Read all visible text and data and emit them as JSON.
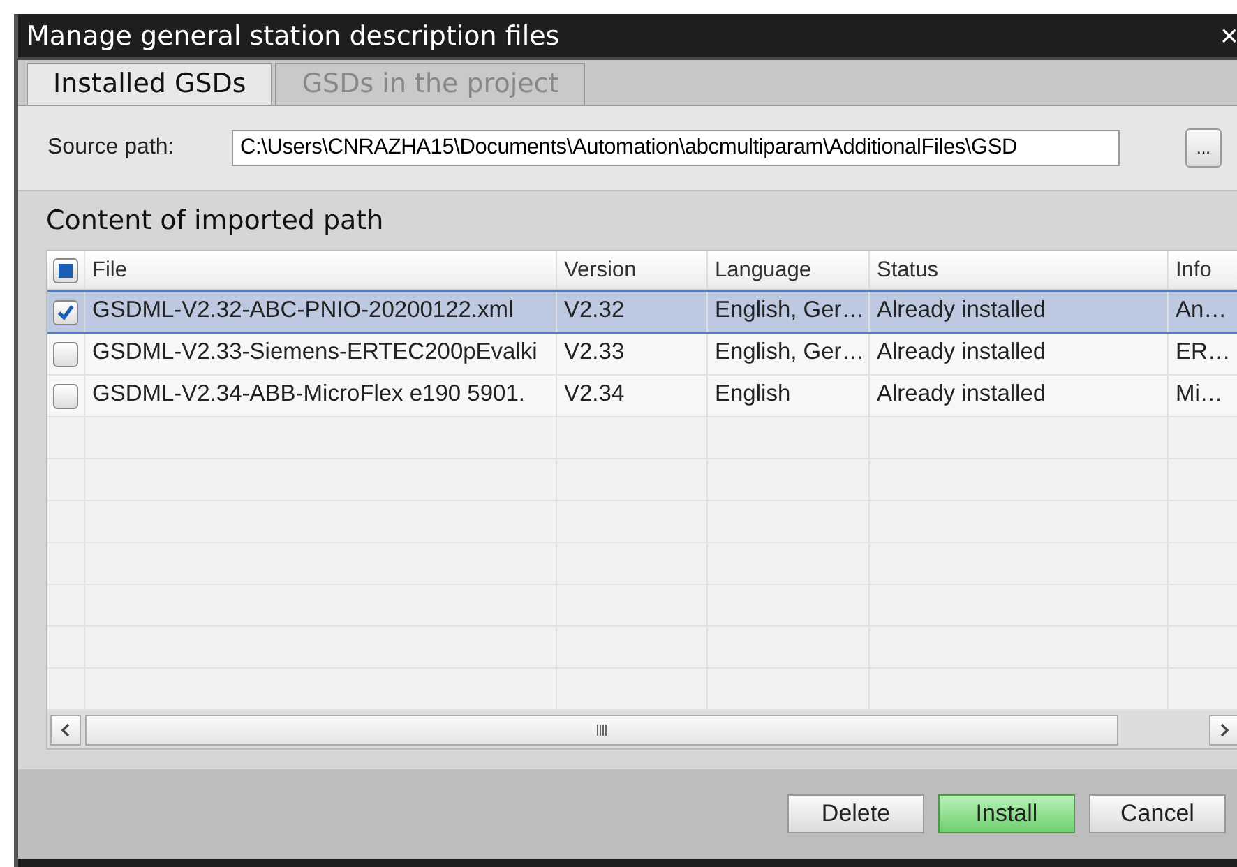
{
  "window": {
    "title": "Manage general station description files",
    "close": "×"
  },
  "tabs": [
    {
      "label": "Installed GSDs",
      "selected": true
    },
    {
      "label": "GSDs in the project",
      "selected": false
    }
  ],
  "source_path": {
    "label": "Source path:",
    "value": "C:\\Users\\CNRAZHA15\\Documents\\Automation\\abcmultiparam\\AdditionalFiles\\GSD",
    "browse": "..."
  },
  "section_title": "Content of imported path",
  "table": {
    "select_all": {
      "indeterminate": true
    },
    "columns": [
      "File",
      "Version",
      "Language",
      "Status",
      "Info"
    ],
    "rows": [
      {
        "checked": true,
        "selected": true,
        "cells": [
          "GSDML-V2.32-ABC-PNIO-20200122.xml",
          "V2.32",
          "English, Ger…",
          "Already installed",
          "An…"
        ]
      },
      {
        "checked": false,
        "selected": false,
        "cells": [
          "GSDML-V2.33-Siemens-ERTEC200pEvalki",
          "V2.33",
          "English, Ger…",
          "Already installed",
          "ER…"
        ]
      },
      {
        "checked": false,
        "selected": false,
        "cells": [
          "GSDML-V2.34-ABB-MicroFlex e190 5901.",
          "V2.34",
          "English",
          "Already installed",
          "Mi…"
        ]
      }
    ]
  },
  "buttons": [
    {
      "label": "Delete",
      "primary": false
    },
    {
      "label": "Install",
      "primary": true
    },
    {
      "label": "Cancel",
      "primary": false
    }
  ]
}
